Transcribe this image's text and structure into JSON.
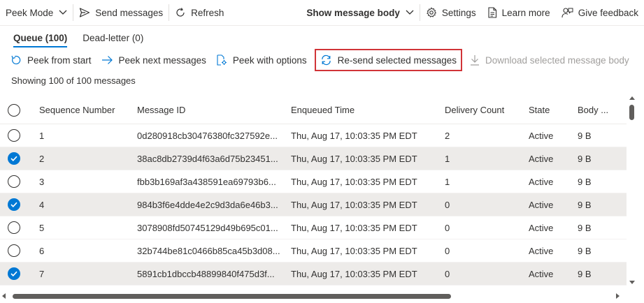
{
  "toolbar": {
    "peek_mode": "Peek Mode",
    "send_messages": "Send messages",
    "refresh": "Refresh",
    "show_message_body": "Show message body",
    "settings": "Settings",
    "learn_more": "Learn more",
    "give_feedback": "Give feedback"
  },
  "tabs": [
    {
      "label": "Queue (100)",
      "active": true
    },
    {
      "label": "Dead-letter (0)",
      "active": false
    }
  ],
  "actions": {
    "peek_from_start": "Peek from start",
    "peek_next": "Peek next messages",
    "peek_with_options": "Peek with options",
    "resend_selected": "Re-send selected messages",
    "download_body": "Download selected message body"
  },
  "status_text": "Showing 100 of 100 messages",
  "columns": {
    "sequence": "Sequence Number",
    "message_id": "Message ID",
    "enqueued": "Enqueued Time",
    "delivery_count": "Delivery Count",
    "state": "State",
    "body": "Body ..."
  },
  "rows": [
    {
      "sequence": "1",
      "message_id": "0d280918cb30476380fc327592e...",
      "enqueued": "Thu, Aug 17, 10:03:35 PM EDT",
      "delivery_count": "2",
      "state": "Active",
      "body": "9 B",
      "selected": false
    },
    {
      "sequence": "2",
      "message_id": "38ac8db2739d4f63a6d75b23451...",
      "enqueued": "Thu, Aug 17, 10:03:35 PM EDT",
      "delivery_count": "1",
      "state": "Active",
      "body": "9 B",
      "selected": true
    },
    {
      "sequence": "3",
      "message_id": "fbb3b169af3a438591ea69793b6...",
      "enqueued": "Thu, Aug 17, 10:03:35 PM EDT",
      "delivery_count": "1",
      "state": "Active",
      "body": "9 B",
      "selected": false
    },
    {
      "sequence": "4",
      "message_id": "984b3f6e4dde4e2c9d3da6e46b3...",
      "enqueued": "Thu, Aug 17, 10:03:35 PM EDT",
      "delivery_count": "0",
      "state": "Active",
      "body": "9 B",
      "selected": true
    },
    {
      "sequence": "5",
      "message_id": "3078908fd50745129d49b695c01...",
      "enqueued": "Thu, Aug 17, 10:03:35 PM EDT",
      "delivery_count": "0",
      "state": "Active",
      "body": "9 B",
      "selected": false
    },
    {
      "sequence": "6",
      "message_id": "32b744be81c0466b85ca45b3d08...",
      "enqueued": "Thu, Aug 17, 10:03:35 PM EDT",
      "delivery_count": "0",
      "state": "Active",
      "body": "9 B",
      "selected": false
    },
    {
      "sequence": "7",
      "message_id": "5891cb1dbccb48899840f475d3f...",
      "enqueued": "Thu, Aug 17, 10:03:35 PM EDT",
      "delivery_count": "0",
      "state": "Active",
      "body": "9 B",
      "selected": true
    }
  ],
  "colors": {
    "accent": "#0078d4",
    "highlight_border": "#d13438",
    "selected_row": "#edebe9",
    "disabled_text": "#a19f9d"
  },
  "icons": {
    "peek_mode": "chevron-down-icon",
    "send": "send-icon",
    "refresh": "refresh-icon",
    "settings": "gear-icon",
    "learn_more": "document-icon",
    "feedback": "person-feedback-icon",
    "peek_from_start": "rotate-left-icon",
    "peek_next": "arrow-right-icon",
    "peek_with_options": "options-icon",
    "resend": "resend-icon",
    "download": "download-icon"
  }
}
